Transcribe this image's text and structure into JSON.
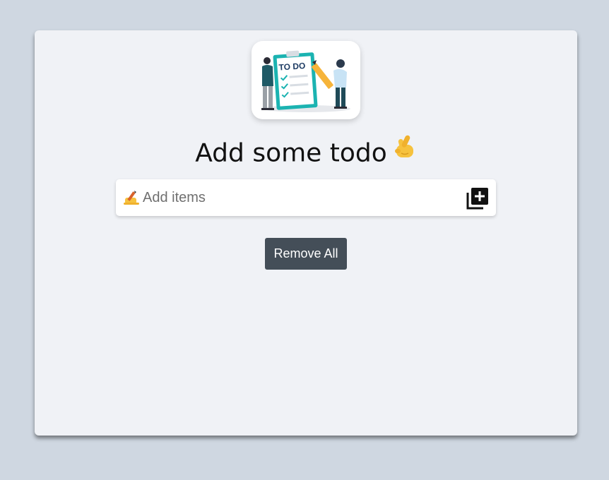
{
  "logo": {
    "icon": "todo-illustration",
    "sign_text": "TO DO"
  },
  "heading": {
    "text": "Add some todo",
    "emoji_icon": "crossed-fingers-icon"
  },
  "input": {
    "placeholder": "Add items",
    "value": "",
    "leading_icon": "writing-hand-icon",
    "add_icon": "add-to-list-icon"
  },
  "actions": {
    "remove_all_label": "Remove All"
  },
  "colors": {
    "page_background": "#cfd7e1",
    "card_background": "#f0f2f6",
    "remove_button": "#444e58",
    "accent_teal": "#1bb3b1"
  }
}
